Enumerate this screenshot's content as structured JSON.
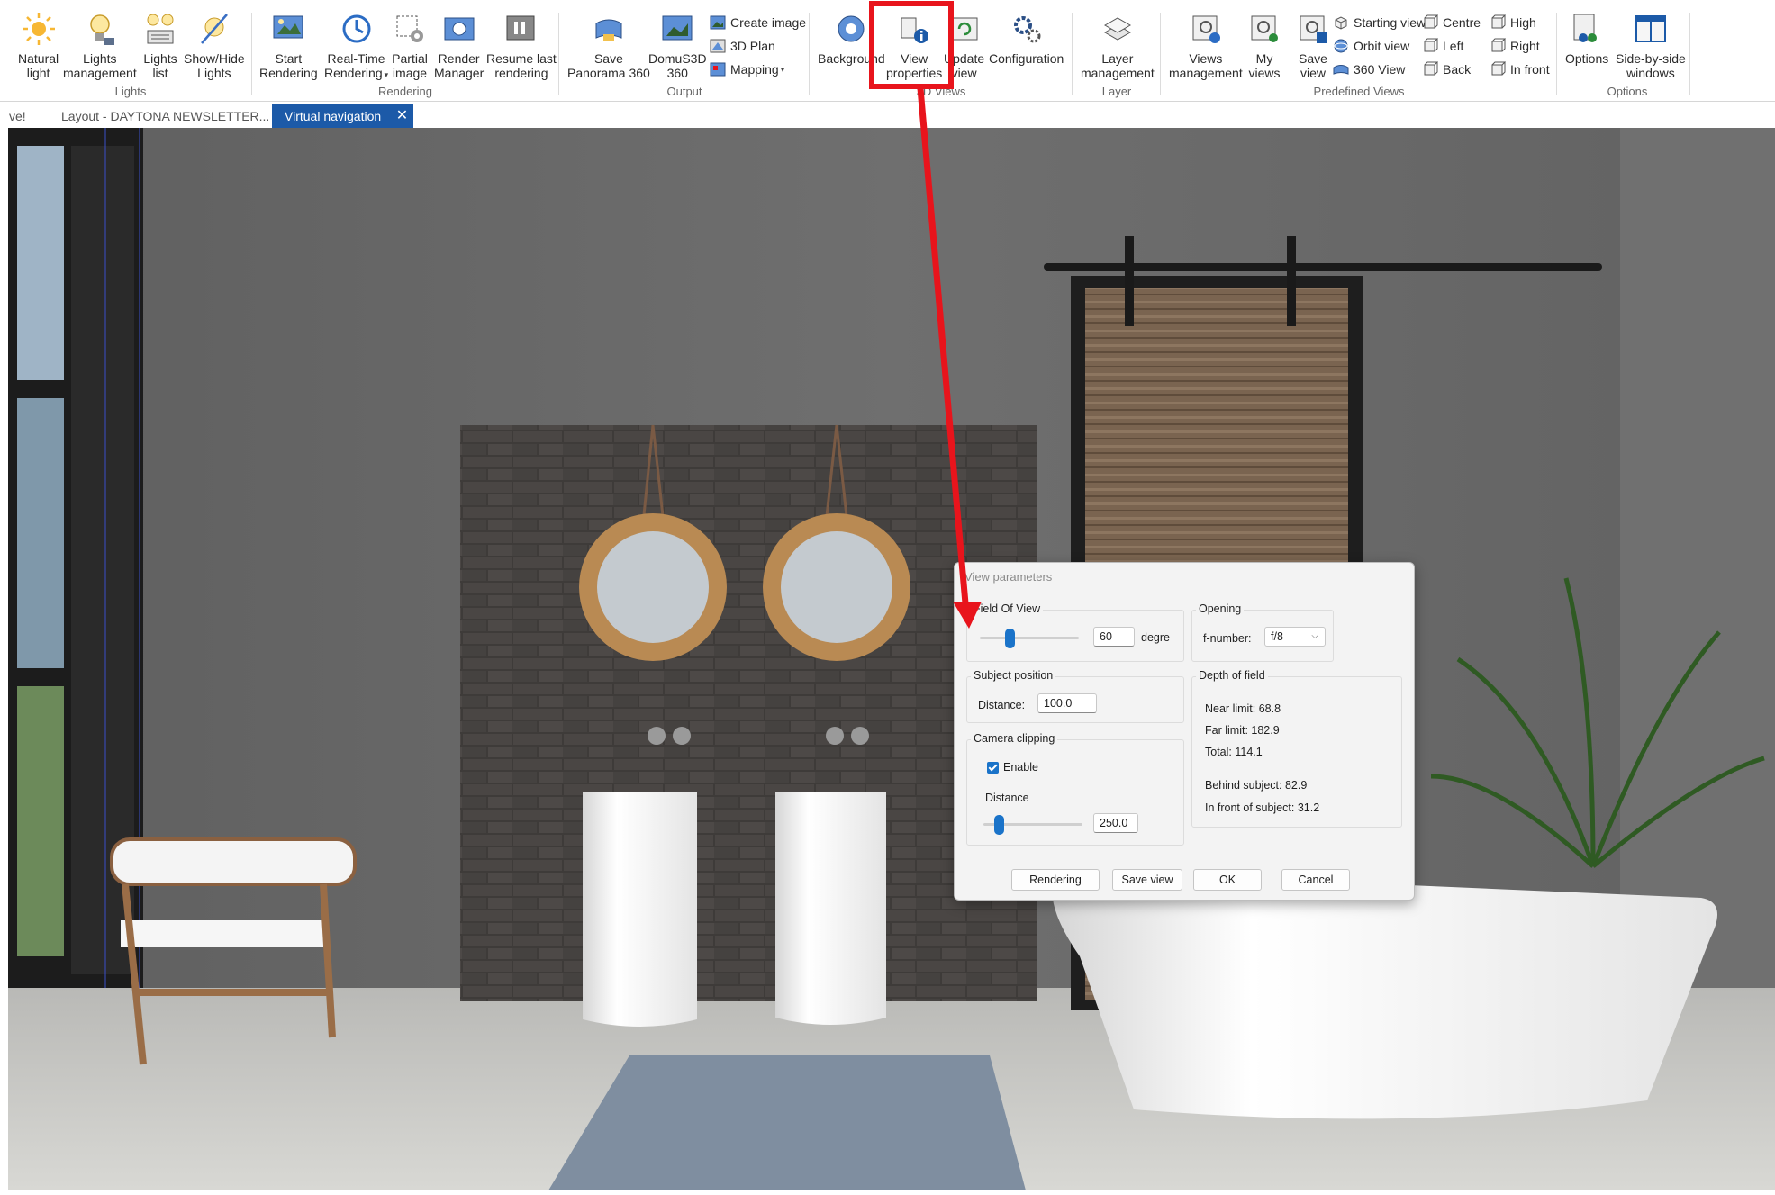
{
  "ribbon": {
    "groups": {
      "lights": "Lights",
      "rendering": "Rendering",
      "output": "Output",
      "views": "3D Views",
      "layer": "Layer",
      "predefined": "Predefined Views",
      "options": "Options"
    },
    "buttons": {
      "natural_light": [
        "Natural",
        "light"
      ],
      "lights_management": [
        "Lights",
        "management"
      ],
      "lights_list": [
        "Lights",
        "list"
      ],
      "show_hide_lights": [
        "Show/Hide",
        "Lights"
      ],
      "start_rendering": [
        "Start",
        "Rendering"
      ],
      "realtime_rendering": [
        "Real-Time",
        "Rendering"
      ],
      "partial_image": [
        "Partial",
        "image"
      ],
      "render_manager": [
        "Render",
        "Manager"
      ],
      "resume_last_rendering": [
        "Resume last",
        "rendering"
      ],
      "save_panorama": [
        "Save",
        "Panorama 360"
      ],
      "domus3d_360": [
        "DomuS3D",
        "360"
      ],
      "create_image": "Create image",
      "plan_3d": "3D Plan",
      "mapping": "Mapping",
      "background": [
        "Background",
        ""
      ],
      "view_properties": [
        "View",
        "properties"
      ],
      "update_view": [
        "Update",
        "view"
      ],
      "configuration": [
        "Configuration",
        ""
      ],
      "layer_management": [
        "Layer",
        "management"
      ],
      "views_management": [
        "Views",
        "management"
      ],
      "my_views": [
        "My",
        "views"
      ],
      "save_view": [
        "Save",
        "view"
      ],
      "starting_view": "Starting view",
      "orbit_view": "Orbit view",
      "view_360": "360 View",
      "centre": "Centre",
      "left": "Left",
      "back": "Back",
      "high": "High",
      "right": "Right",
      "in_front": "In front",
      "options": [
        "Options",
        ""
      ],
      "side_by_side": [
        "Side-by-side",
        "windows"
      ]
    }
  },
  "tabs": [
    {
      "label": "ve!"
    },
    {
      "label": "Layout - DAYTONA NEWSLETTER..."
    },
    {
      "label": "Virtual navigation",
      "close": "✕"
    }
  ],
  "dialog": {
    "title": "View parameters",
    "fov": {
      "title": "Field Of View",
      "value": "60",
      "unit": "degre",
      "level": 0.3
    },
    "opening": {
      "title": "Opening",
      "label": "f-number:",
      "value": "f/8"
    },
    "subject": {
      "title": "Subject position",
      "label": "Distance:",
      "value": "100.0"
    },
    "dof": {
      "title": "Depth of field",
      "near": "Near limit: 68.8",
      "far": "Far limit: 182.9",
      "total": "Total: 114.1",
      "behind": "Behind subject: 82.9",
      "front": "In front of subject: 31.2"
    },
    "clipping": {
      "title": "Camera clipping",
      "enable": "Enable",
      "enabled": true,
      "distance_label": "Distance",
      "value": "250.0",
      "level": 0.15
    },
    "buttons": {
      "rendering": "Rendering",
      "save_view": "Save view",
      "ok": "OK",
      "cancel": "Cancel"
    }
  },
  "colors": {
    "ribbon_accent": "#1c5aa8",
    "highlight": "#e8141c",
    "slider": "#1a73c9"
  }
}
